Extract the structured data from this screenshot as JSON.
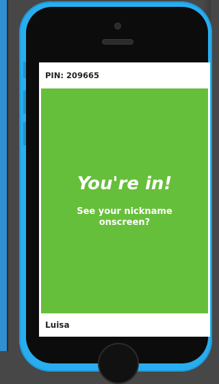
{
  "game": {
    "pin_label": "PIN: 209665",
    "joined_title": "You're in!",
    "instruction_line1": "See your nickname",
    "instruction_line2": "onscreen?",
    "nickname": "Luisa"
  },
  "colors": {
    "phone_body": "#28aef0",
    "panel_green": "#66bf3a",
    "text_dark": "#222222",
    "background": "#474747"
  }
}
